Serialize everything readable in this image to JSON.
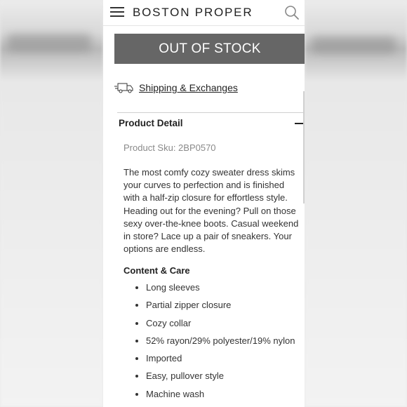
{
  "header": {
    "brand": "BOSTON PROPER",
    "menu_icon": "hamburger-menu-icon",
    "search_icon": "search-icon"
  },
  "product": {
    "stock_button": "OUT OF STOCK",
    "shipping_link": "Shipping & Exchanges",
    "shipping_icon": "truck-icon",
    "detail_heading": "Product Detail",
    "collapse_icon": "minus-icon",
    "sku": "Product Sku: 2BP0570",
    "description": "The most comfy cozy sweater dress skims your curves to perfection and is finished with a half-zip closure for effortless style. Heading out for the evening? Pull on those sexy over-the-knee boots. Casual weekend in store? Lace up a pair of sneakers. Your options are endless.",
    "care_heading": "Content & Care",
    "care_items": [
      "Long sleeves",
      "Partial zipper closure",
      "Cozy collar",
      "52% rayon/29% polyester/19% nylon",
      "Imported",
      "Easy, pullover style",
      "Machine wash"
    ]
  },
  "colors": {
    "button_bg": "#666666",
    "text": "#333333",
    "muted": "#8a8a8a"
  }
}
